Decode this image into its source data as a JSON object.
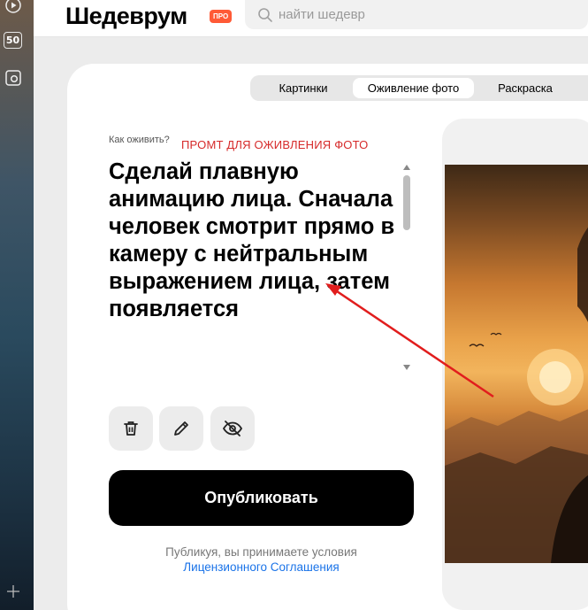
{
  "sidebar": {
    "play_icon": "play-circle-icon",
    "counter_badge": "50",
    "screenshot_icon": "camera-screenshot-icon",
    "add_icon": "plus-icon"
  },
  "header": {
    "logo": "Шедеврум",
    "badge": "ПРО",
    "search_placeholder": "найти шедевр"
  },
  "tabs": [
    {
      "label": "Картинки",
      "active": false
    },
    {
      "label": "Оживление фото",
      "active": true
    },
    {
      "label": "Раскраска",
      "active": false
    }
  ],
  "editor": {
    "how_label": "Как оживить?",
    "annotation": "ПРОМТ ДЛЯ ОЖИВЛЕНИЯ ФОТО",
    "prompt": "Сделай плавную анимацию лица. Сначала человек смотрит прямо в камеру с нейтральным выражением лица, затем появляется",
    "actions": [
      "trash-icon",
      "pencil-icon",
      "eye-off-icon"
    ],
    "publish_label": "Опубликовать",
    "terms_text": "Публикуя, вы принимаете условия",
    "terms_link": "Лицензионного Соглашения"
  },
  "colors": {
    "accent_badge": "#ff5a36",
    "annotation": "#d62a2a",
    "link": "#1a73e8",
    "publish_button": "#000000"
  }
}
